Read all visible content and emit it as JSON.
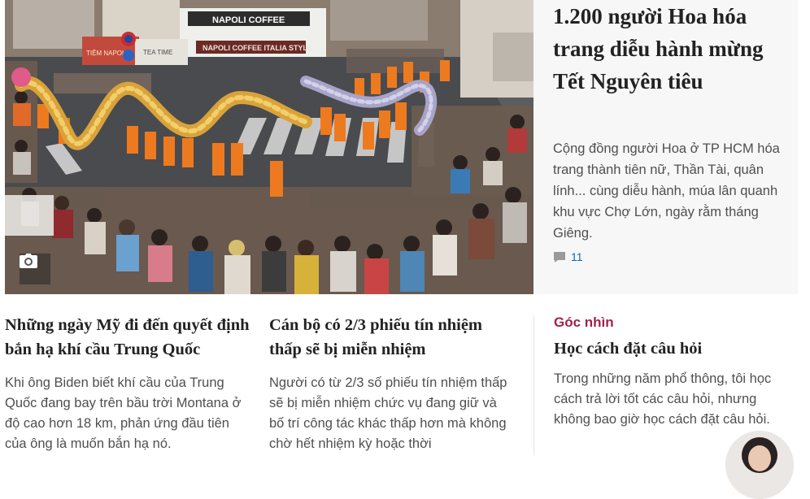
{
  "hero": {
    "title": "1.200 người Hoa hóa trang diễu hành mừng Tết Nguyên tiêu",
    "description": "Cộng đồng người Hoa ở TP HCM hóa trang thành tiên nữ, Thần Tài, quân lính... cùng diễu hành, múa lân quanh khu vực Chợ Lớn, ngày rằm tháng Giêng.",
    "comment_count": "11",
    "photo_signs": {
      "cafe_sign": "NAPOLI COFFEE",
      "cafe_awning": "NAPOLI COFFEE ITALIA STYLE",
      "shop_sign": "TIỆM NAPOLI",
      "small_awning": "TEA TIME"
    },
    "camera_icon": "camera-icon"
  },
  "articles": [
    {
      "title": "Những ngày Mỹ đi đến quyết định bắn hạ khí cầu Trung Quốc",
      "description": "Khi ông Biden biết khí cầu của Trung Quốc đang bay trên bầu trời Montana ở độ cao hơn 18 km, phản ứng đầu tiên của ông là muốn bắn hạ nó."
    },
    {
      "title": "Cán bộ có 2/3 phiếu tín nhiệm thấp sẽ bị miễn nhiệm",
      "description": "Người có từ 2/3 số phiếu tín nhiệm thấp sẽ bị miễn nhiệm chức vụ đang giữ và bố trí công tác khác thấp hơn mà không chờ hết nhiệm kỳ hoặc thời"
    }
  ],
  "opinion": {
    "kicker": "Góc nhìn",
    "title": "Học cách đặt câu hỏi",
    "description": "Trong những năm phổ thông, tôi học cách trả lời tốt các câu hỏi, nhưng không bao giờ học cách đặt câu hỏi."
  },
  "colors": {
    "kicker": "#9f224e",
    "link": "#076db6",
    "panel_bg": "#f7f7f7"
  }
}
